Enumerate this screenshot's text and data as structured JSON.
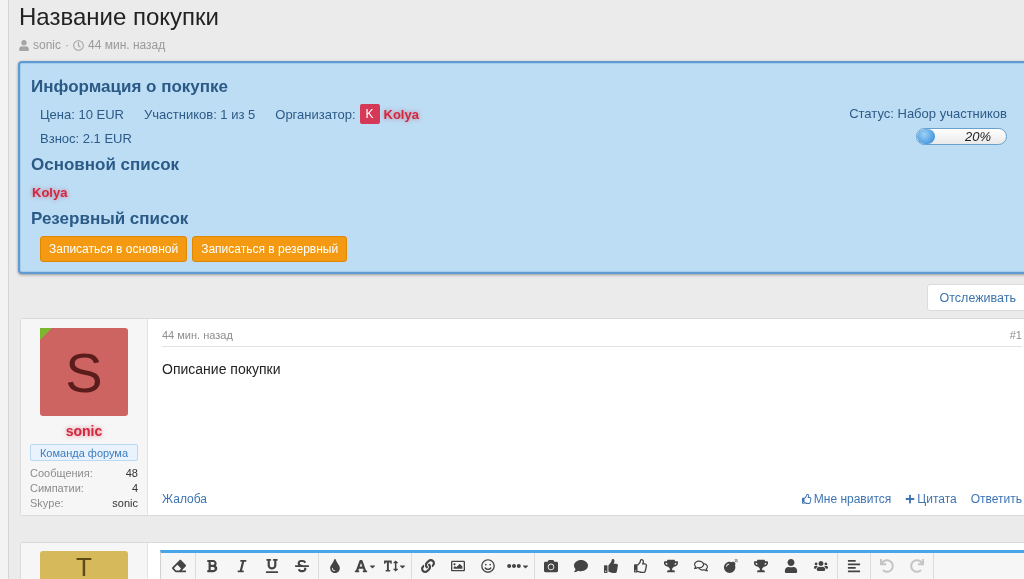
{
  "page": {
    "title": "Название покупки",
    "author": "sonic",
    "separator": "·",
    "time": "44 мин. назад"
  },
  "purchase_info": {
    "title": "Информация о покупке",
    "details": [
      "Цена: 10 EUR",
      "Участников: 1 из 5"
    ],
    "organizer": {
      "label": "Организатор:",
      "initial": "K",
      "name": "Kolya"
    },
    "fee": "Взнос: 2.1 EUR",
    "status": "Статус: Набор участников",
    "progress": {
      "level": 0.2,
      "reading": "20%"
    },
    "main_list": {
      "title": "Основной список",
      "members": [
        "Kolya"
      ]
    },
    "reserve_list": {
      "title": "Резервный список"
    },
    "buttons": [
      "Записаться в основной",
      "Записаться в резервный"
    ]
  },
  "follow_button": "Отслеживать",
  "posts": [
    {
      "author": {
        "name": "sonic",
        "initial": "S",
        "online": true,
        "title": "Команда форума",
        "stats": [
          {
            "label": "Сообщения:",
            "value": "48"
          },
          {
            "label": "Симпатии:",
            "value": "4"
          },
          {
            "label": "Skype:",
            "value": "sonic"
          }
        ]
      },
      "time": "44 мин. назад",
      "number": "#1",
      "body": "Описание покупки",
      "report": "Жалоба",
      "actions": [
        {
          "kind": "like",
          "label": "Мне нравится"
        },
        {
          "kind": "quote",
          "label": "Цитата"
        },
        {
          "kind": "reply",
          "label": "Ответить"
        }
      ]
    }
  ],
  "reply_editor": {
    "avatar_initial": "T",
    "toolbar": [
      {
        "buttons": [
          {
            "kind": "eraser",
            "dropdown": false,
            "disabled": false
          }
        ]
      },
      {
        "buttons": [
          {
            "kind": "bold",
            "dropdown": false,
            "disabled": false
          },
          {
            "kind": "italic",
            "dropdown": false,
            "disabled": false
          },
          {
            "kind": "underline",
            "dropdown": false,
            "disabled": false
          },
          {
            "kind": "strike",
            "dropdown": false,
            "disabled": false
          }
        ]
      },
      {
        "buttons": [
          {
            "kind": "color",
            "dropdown": false,
            "disabled": false
          },
          {
            "kind": "font",
            "dropdown": true,
            "disabled": false
          },
          {
            "kind": "size",
            "dropdown": true,
            "disabled": false
          }
        ]
      },
      {
        "buttons": [
          {
            "kind": "link",
            "dropdown": false,
            "disabled": false
          },
          {
            "kind": "image",
            "dropdown": false,
            "disabled": false
          },
          {
            "kind": "smilie",
            "dropdown": false,
            "disabled": false
          },
          {
            "kind": "more",
            "dropdown": true,
            "disabled": false
          }
        ]
      },
      {
        "buttons": [
          {
            "kind": "camera",
            "dropdown": false,
            "disabled": false
          },
          {
            "kind": "comment",
            "dropdown": false,
            "disabled": false
          },
          {
            "kind": "thumbsup",
            "dropdown": false,
            "disabled": false
          },
          {
            "kind": "thumbsupoutline",
            "dropdown": false,
            "disabled": false
          },
          {
            "kind": "trophy",
            "dropdown": false,
            "disabled": false
          },
          {
            "kind": "comments",
            "dropdown": false,
            "disabled": false
          },
          {
            "kind": "bomb",
            "dropdown": false,
            "disabled": false
          },
          {
            "kind": "trophy",
            "dropdown": false,
            "disabled": false
          },
          {
            "kind": "user",
            "dropdown": false,
            "disabled": false
          },
          {
            "kind": "users",
            "dropdown": false,
            "disabled": false
          }
        ]
      },
      {
        "buttons": [
          {
            "kind": "align",
            "dropdown": false,
            "disabled": false
          }
        ]
      },
      {
        "buttons": [
          {
            "kind": "undo",
            "dropdown": false,
            "disabled": true
          },
          {
            "kind": "redo",
            "dropdown": false,
            "disabled": true
          }
        ]
      }
    ]
  }
}
